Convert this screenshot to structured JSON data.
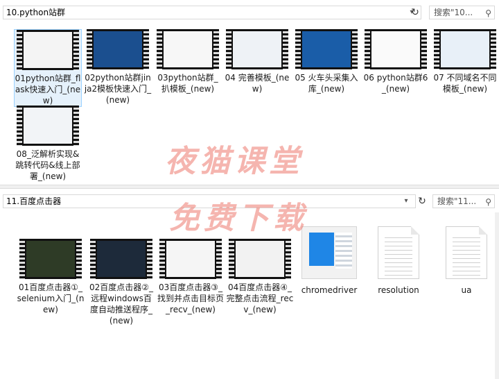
{
  "top_window": {
    "path": "10.python站群",
    "search_placeholder": "搜索\"10...",
    "items": [
      {
        "label": "01python站群_flask快速入门_(new)",
        "screen": "#f4f4f4"
      },
      {
        "label": "02python站群jinja2模板快速入门_(new)",
        "screen": "#1b4f8f"
      },
      {
        "label": "03python站群_扒模板_(new)",
        "screen": "#f7f7f7"
      },
      {
        "label": "04 完善模板_(new)",
        "screen": "#eef2f6"
      },
      {
        "label": "05 火车头采集入库_(new)",
        "screen": "#1a5da8"
      },
      {
        "label": "06 python站群6_(new)",
        "screen": "#fafafa"
      },
      {
        "label": "07 不同域名不同模板_(new)",
        "screen": "#e8f0f8"
      },
      {
        "label": "08_泛解析实现&跳转代码&线上部署_(new)",
        "screen": "#f2f4f7"
      }
    ]
  },
  "bottom_window": {
    "path": "11.百度点击器",
    "search_placeholder": "搜索\"11...",
    "items": [
      {
        "label": "01百度点击器①_selenium入门_(new)",
        "kind": "video",
        "screen": "#2e3b26"
      },
      {
        "label": "02百度点击器②_远程windows百度自动推送程序_(new)",
        "kind": "video",
        "screen": "#1d2a3a"
      },
      {
        "label": "03百度点击器③_找到并点击目标页_recv_(new)",
        "kind": "video",
        "screen": "#f5f5f5"
      },
      {
        "label": "04百度点击器④_完整点击流程_recv_(new)",
        "kind": "video",
        "screen": "#f2f2f2"
      },
      {
        "label": "chromedriver",
        "kind": "exe"
      },
      {
        "label": "resolution",
        "kind": "doc"
      },
      {
        "label": "ua",
        "kind": "doc"
      }
    ]
  },
  "watermark": {
    "line1": "夜猫课堂",
    "line2": "免费下载"
  }
}
